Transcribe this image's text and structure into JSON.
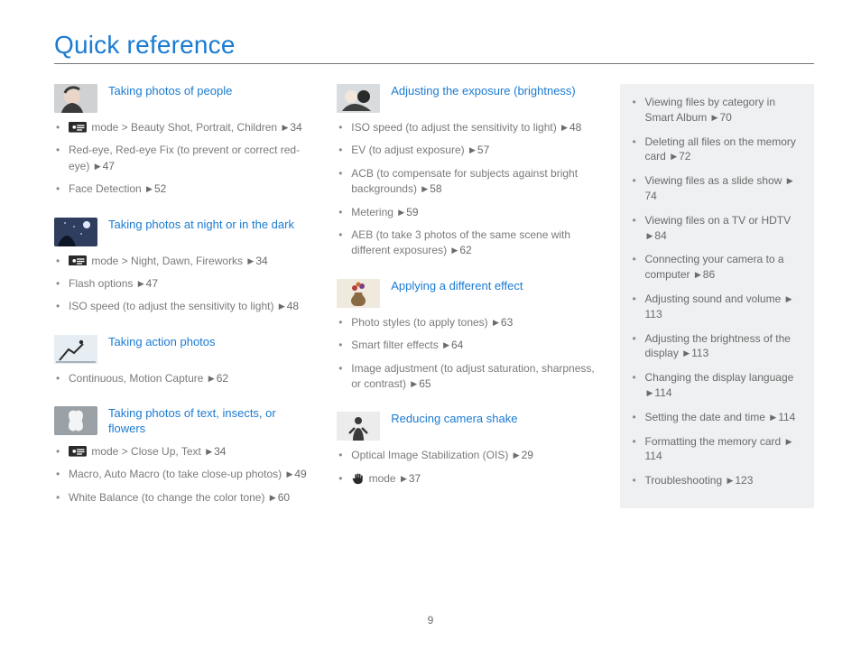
{
  "page_title": "Quick reference",
  "page_number": "9",
  "columns": {
    "left": [
      {
        "title": "Taking photos of people",
        "thumb": "portrait",
        "items": [
          {
            "prefix_icon": "scene",
            "text": " mode > Beauty Shot, Portrait, Children ",
            "page": "34"
          },
          {
            "text": "Red-eye, Red-eye Fix (to prevent or correct red-eye) ",
            "page": "47"
          },
          {
            "text": "Face Detection ",
            "page": "52"
          }
        ]
      },
      {
        "title": "Taking photos at night or in the dark",
        "thumb": "night",
        "items": [
          {
            "prefix_icon": "scene",
            "text": " mode > Night, Dawn, Fireworks ",
            "page": "34"
          },
          {
            "text": "Flash options ",
            "page": "47"
          },
          {
            "text": "ISO speed (to adjust the sensitivity to light) ",
            "page": "48"
          }
        ]
      },
      {
        "title": "Taking action photos",
        "thumb": "action",
        "items": [
          {
            "text": "Continuous, Motion Capture ",
            "page": "62"
          }
        ]
      },
      {
        "title": "Taking photos of text, insects, or flowers",
        "thumb": "macro",
        "items": [
          {
            "prefix_icon": "scene",
            "text": " mode > Close Up, Text ",
            "page": "34"
          },
          {
            "text": "Macro, Auto Macro (to take close-up photos) ",
            "page": "49"
          },
          {
            "text": "White Balance (to change the color tone) ",
            "page": "60"
          }
        ]
      }
    ],
    "mid": [
      {
        "title": "Adjusting the exposure (brightness)",
        "thumb": "exposure",
        "items": [
          {
            "text": "ISO speed (to adjust the sensitivity to light) ",
            "page": "48"
          },
          {
            "text": "EV (to adjust exposure) ",
            "page": "57"
          },
          {
            "text": "ACB (to compensate for subjects against bright backgrounds) ",
            "page": "58"
          },
          {
            "text": "Metering ",
            "page": "59"
          },
          {
            "text": "AEB (to take 3 photos of the same scene with different exposures) ",
            "page": "62"
          }
        ]
      },
      {
        "title": "Applying a different effect",
        "thumb": "vase",
        "items": [
          {
            "text": "Photo styles (to apply tones) ",
            "page": "63"
          },
          {
            "text": "Smart filter effects ",
            "page": "64"
          },
          {
            "text": "Image adjustment (to adjust saturation, sharpness, or contrast) ",
            "page": "65"
          }
        ]
      },
      {
        "title": "Reducing camera shake",
        "thumb": "shake",
        "items": [
          {
            "text": "Optical Image Stabilization (OIS) ",
            "page": "29"
          },
          {
            "prefix_icon": "hand",
            "text": " mode ",
            "page": "37"
          }
        ]
      }
    ]
  },
  "sidebar": [
    {
      "text": "Viewing files by category in Smart Album ",
      "page": "70"
    },
    {
      "text": "Deleting all files on the memory card ",
      "page": "72"
    },
    {
      "text": "Viewing files as a slide show ",
      "page": "74"
    },
    {
      "text": "Viewing files on a TV or HDTV ",
      "page": "84"
    },
    {
      "text": "Connecting your camera to a computer ",
      "page": "86"
    },
    {
      "text": "Adjusting sound and volume ",
      "page": "113"
    },
    {
      "text": "Adjusting the brightness of the display ",
      "page": "113"
    },
    {
      "text": "Changing the display language ",
      "page": "114"
    },
    {
      "text": "Setting the date and time ",
      "page": "114"
    },
    {
      "text": "Formatting the memory card ",
      "page": "114"
    },
    {
      "text": "Troubleshooting ",
      "page": "123"
    }
  ]
}
